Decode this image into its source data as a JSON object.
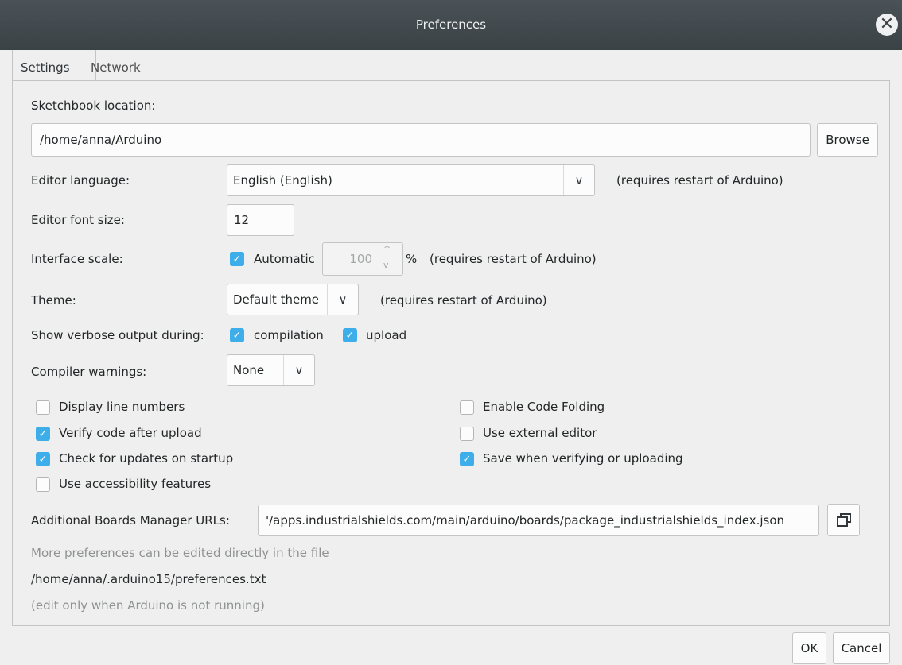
{
  "window": {
    "title": "Preferences"
  },
  "tabs": [
    {
      "label": "Settings"
    },
    {
      "label": "Network"
    }
  ],
  "sketchbook": {
    "label": "Sketchbook location:",
    "path": "/home/anna/Arduino",
    "browse_label": "Browse"
  },
  "language": {
    "label": "Editor language:",
    "value": "English (English)",
    "note": "(requires restart of Arduino)"
  },
  "font_size": {
    "label": "Editor font size:",
    "value": "12"
  },
  "scale": {
    "label": "Interface scale:",
    "automatic_label": "Automatic",
    "automatic_checked": true,
    "value": "100",
    "unit": "%",
    "note": "(requires restart of Arduino)"
  },
  "theme": {
    "label": "Theme:",
    "value": "Default theme",
    "note": "(requires restart of Arduino)"
  },
  "verbose": {
    "label": "Show verbose output during:",
    "compilation_label": "compilation",
    "compilation_checked": true,
    "upload_label": "upload",
    "upload_checked": true
  },
  "warnings": {
    "label": "Compiler warnings:",
    "value": "None"
  },
  "options": {
    "display_line_numbers": {
      "label": "Display line numbers",
      "checked": false
    },
    "verify_after_upload": {
      "label": "Verify code after upload",
      "checked": true
    },
    "check_updates": {
      "label": "Check for updates on startup",
      "checked": true
    },
    "accessibility": {
      "label": "Use accessibility features",
      "checked": false
    },
    "code_folding": {
      "label": "Enable Code Folding",
      "checked": false
    },
    "external_editor": {
      "label": "Use external editor",
      "checked": false
    },
    "save_when_verifying": {
      "label": "Save when verifying or uploading",
      "checked": true
    }
  },
  "boards_urls": {
    "label": "Additional Boards Manager URLs:",
    "value": "'/apps.industrialshields.com/main/arduino/boards/package_industrialshields_index.json"
  },
  "footer": {
    "more_prefs": "More preferences can be edited directly in the file",
    "prefs_path": "/home/anna/.arduino15/preferences.txt",
    "edit_note": "(edit only when Arduino is not running)"
  },
  "buttons": {
    "ok_label": "OK",
    "cancel_label": "Cancel"
  },
  "icons": {
    "close": "close-icon",
    "check": "checkmark-icon",
    "chevron": "chevron-down-icon",
    "window": "open-window-icon"
  }
}
